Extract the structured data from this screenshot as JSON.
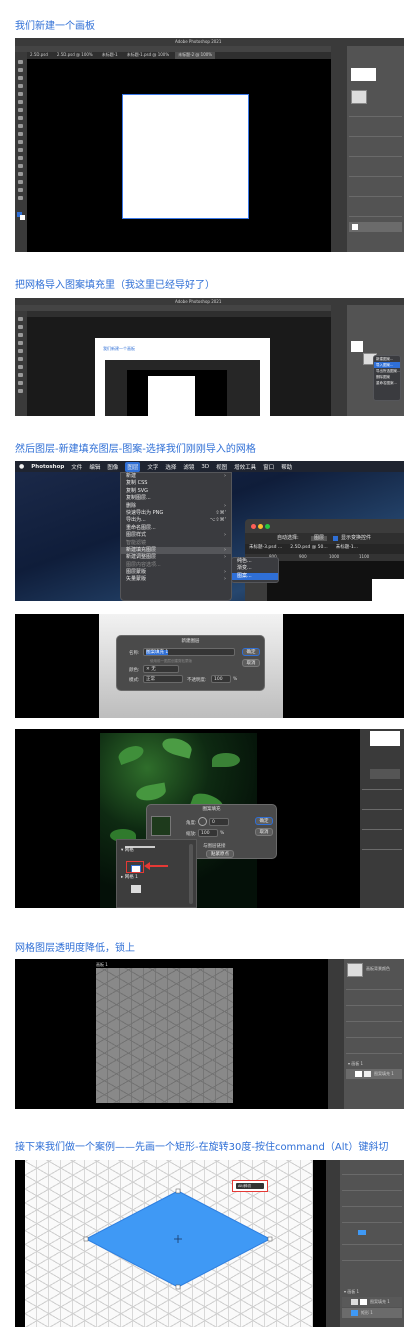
{
  "steps": [
    {
      "heading": "我们新建一个画板"
    },
    {
      "heading": "把网格导入图案填充里（我这里已经导好了）"
    },
    {
      "heading": "然后图层-新建填充图层-图案-选择我们刚刚导入的网格"
    },
    {
      "heading": "网格图层透明度降低，锁上"
    },
    {
      "heading": "接下来我们做一个案例——先画一个矩形-在旋转30度-按住command（Alt）键斜切"
    }
  ],
  "shot1": {
    "app_title": "Adobe Photoshop 2021",
    "doc_tabs": [
      "2.5D.psd",
      "2.5D.psd @ 100%",
      "未标题-1",
      "未标题-1.psd @ 100%",
      "未标题-2 @ 100%"
    ]
  },
  "shot2": {
    "app_title": "Adobe Photoshop 2021",
    "inner_caption": "我们新建一个画板",
    "context_menu": [
      "新建图案...",
      "导入图案...",
      "导出所选图案...",
      "删除图案",
      "重命名图案..."
    ]
  },
  "shot3": {
    "mac_menu": [
      "Photoshop",
      "文件",
      "编辑",
      "图像",
      "图层",
      "文字",
      "选择",
      "滤镜",
      "3D",
      "视图",
      "增效工具",
      "窗口",
      "帮助"
    ],
    "layer_menu": [
      {
        "label": "新建",
        "shortcut": "",
        "dim": false
      },
      {
        "label": "复制 CSS",
        "shortcut": "",
        "dim": false
      },
      {
        "label": "复制 SVG",
        "shortcut": "",
        "dim": false
      },
      {
        "label": "复制图层...",
        "shortcut": "",
        "dim": false
      },
      {
        "label": "删除",
        "shortcut": "",
        "dim": false
      },
      {
        "label": "快速导出为 PNG",
        "shortcut": "⇧⌘'",
        "dim": false
      },
      {
        "label": "导出为...",
        "shortcut": "⌥⇧⌘'",
        "dim": false
      },
      {
        "label": "重命名图层...",
        "shortcut": "",
        "dim": false
      },
      {
        "label": "图层样式",
        "shortcut": "",
        "dim": false
      },
      {
        "label": "智能滤镜",
        "shortcut": "",
        "dim": true
      },
      {
        "label": "新建填充图层",
        "shortcut": "",
        "dim": false
      },
      {
        "label": "新建调整图层",
        "shortcut": "",
        "dim": false
      },
      {
        "label": "图层内容选项...",
        "shortcut": "",
        "dim": true
      },
      {
        "label": "图层蒙版",
        "shortcut": "",
        "dim": false
      },
      {
        "label": "矢量蒙版",
        "shortcut": "",
        "dim": false
      }
    ],
    "submenu": [
      "纯色...",
      "渐变...",
      "图案..."
    ],
    "options_bar": {
      "auto_select": "自动选择:",
      "layer": "图层",
      "show_transform": "显示变换控件"
    },
    "tabs": [
      "未标题-3.psd ...",
      "2.5D.psd @ 50...",
      "未标题-1..."
    ],
    "ruler": [
      "800",
      "900",
      "1000",
      "1100"
    ]
  },
  "shot4": {
    "dialog_title": "新建图层",
    "name_label": "名称:",
    "name_value": "图案填充 1",
    "clip_option": "使用前一图层创建剪贴蒙版",
    "color_label": "颜色:",
    "color_value": "无",
    "mode_label": "模式:",
    "mode_value": "正常",
    "opacity_label": "不透明度:",
    "opacity_value": "100",
    "opacity_unit": "%",
    "ok": "确定",
    "cancel": "取消"
  },
  "shot5": {
    "dialog_title": "图案填充",
    "angle_label": "角度:",
    "angle_value": "0",
    "scale_label": "缩放:",
    "scale_value": "100",
    "scale_unit": "%",
    "link_layer": "与图层链接",
    "snap_origin": "贴紧原点",
    "ok": "确定",
    "cancel": "取消",
    "pattern_folders": [
      "网格",
      "网格 1"
    ]
  },
  "shot6": {
    "canvas_label": "画板 1",
    "panel_title": "画板背景颜色",
    "layers": [
      "画板 1",
      "图案填充 1"
    ]
  },
  "shot7": {
    "callout": "Alt/斜切",
    "layers": [
      "画板 1",
      "图案填充 1",
      "矩形 1"
    ]
  }
}
